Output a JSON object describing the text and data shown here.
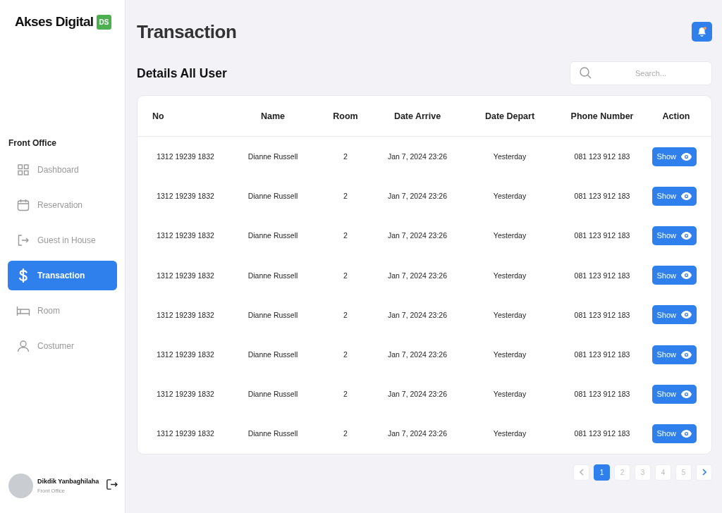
{
  "brand": {
    "name": "Akses Digital",
    "badge": "DS"
  },
  "sidebar": {
    "section": "Front Office",
    "items": [
      {
        "label": "Dashboard",
        "selected": false
      },
      {
        "label": "Reservation",
        "selected": false
      },
      {
        "label": "Guest in House",
        "selected": false
      },
      {
        "label": "Transaction",
        "selected": true
      },
      {
        "label": "Room",
        "selected": false
      },
      {
        "label": "Costumer",
        "selected": false
      }
    ]
  },
  "user": {
    "name": "Dikdik Yanbaghilaha",
    "role": "Front Office"
  },
  "page_title": "Transaction",
  "notifications": {
    "unread": true
  },
  "section_title": "Details All User",
  "search": {
    "placeholder": "Search..."
  },
  "table": {
    "columns": [
      "No",
      "Name",
      "Room",
      "Date Arrive",
      "Date Depart",
      "Phone Number",
      "Action"
    ],
    "rows": [
      {
        "no": "1312 19239 1832",
        "name": "Dianne Russell",
        "room": "2",
        "arrive": "Jan 7, 2024 23:26",
        "depart": "Yesterday",
        "phone": "081 123 912 183",
        "action": "Show"
      },
      {
        "no": "1312 19239 1832",
        "name": "Dianne Russell",
        "room": "2",
        "arrive": "Jan 7, 2024 23:26",
        "depart": "Yesterday",
        "phone": "081 123 912 183",
        "action": "Show"
      },
      {
        "no": "1312 19239 1832",
        "name": "Dianne Russell",
        "room": "2",
        "arrive": "Jan 7, 2024 23:26",
        "depart": "Yesterday",
        "phone": "081 123 912 183",
        "action": "Show"
      },
      {
        "no": "1312 19239 1832",
        "name": "Dianne Russell",
        "room": "2",
        "arrive": "Jan 7, 2024 23:26",
        "depart": "Yesterday",
        "phone": "081 123 912 183",
        "action": "Show"
      },
      {
        "no": "1312 19239 1832",
        "name": "Dianne Russell",
        "room": "2",
        "arrive": "Jan 7, 2024 23:26",
        "depart": "Yesterday",
        "phone": "081 123 912 183",
        "action": "Show"
      },
      {
        "no": "1312 19239 1832",
        "name": "Dianne Russell",
        "room": "2",
        "arrive": "Jan 7, 2024 23:26",
        "depart": "Yesterday",
        "phone": "081 123 912 183",
        "action": "Show"
      },
      {
        "no": "1312 19239 1832",
        "name": "Dianne Russell",
        "room": "2",
        "arrive": "Jan 7, 2024 23:26",
        "depart": "Yesterday",
        "phone": "081 123 912 183",
        "action": "Show"
      },
      {
        "no": "1312 19239 1832",
        "name": "Dianne Russell",
        "room": "2",
        "arrive": "Jan 7, 2024 23:26",
        "depart": "Yesterday",
        "phone": "081 123 912 183",
        "action": "Show"
      }
    ]
  },
  "pagination": {
    "prev": {
      "disabled": true
    },
    "pages": [
      {
        "label": "1",
        "selected": true
      },
      {
        "label": "2",
        "selected": false
      },
      {
        "label": "3",
        "selected": false
      },
      {
        "label": "4",
        "selected": false
      },
      {
        "label": "5",
        "selected": false
      }
    ],
    "next": {
      "disabled": false
    }
  }
}
